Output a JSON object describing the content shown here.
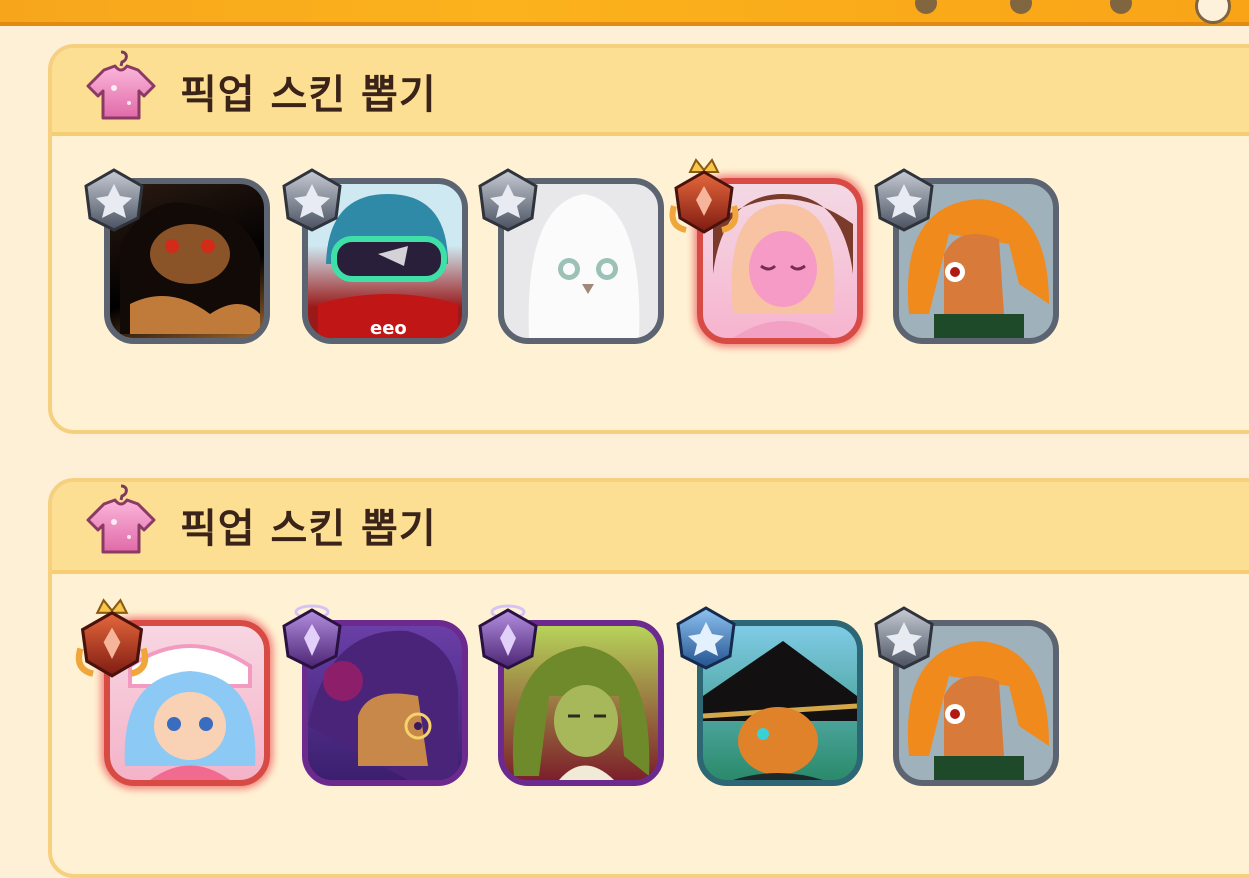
{
  "colors": {
    "panel_bg": "#fff2d4",
    "header_bg": "#fddf93",
    "title_text": "#3a2318",
    "frame_common": "#5b6470",
    "frame_legendary": "#d84a44",
    "frame_epic": "#6c2a8e",
    "frame_rare": "#2d6674"
  },
  "sections": [
    {
      "title": "픽업 스킨 뽑기",
      "icon": "shirt-icon",
      "skins": [
        {
          "grade": "common",
          "badge": "silver-gem-icon",
          "portrait": "dark-beast-cookie"
        },
        {
          "grade": "common",
          "badge": "silver-gem-icon",
          "portrait": "goggles-helmet-cookie"
        },
        {
          "grade": "common",
          "badge": "silver-gem-icon",
          "portrait": "white-ghost-cookie"
        },
        {
          "grade": "legendary",
          "badge": "red-crown-gem-icon",
          "portrait": "pink-princess-cookie"
        },
        {
          "grade": "common",
          "badge": "silver-gem-icon",
          "portrait": "orange-hair-cookie"
        }
      ]
    },
    {
      "title": "픽업 스킨 뽑기",
      "icon": "shirt-icon",
      "skins": [
        {
          "grade": "legendary",
          "badge": "red-crown-gem-icon",
          "portrait": "blue-hair-maid-cookie"
        },
        {
          "grade": "epic",
          "badge": "purple-halo-gem-icon",
          "portrait": "purple-rose-cookie"
        },
        {
          "grade": "epic",
          "badge": "purple-halo-gem-icon",
          "portrait": "green-hair-cookie"
        },
        {
          "grade": "rare",
          "badge": "blue-gem-icon",
          "portrait": "black-hat-cookie"
        },
        {
          "grade": "common",
          "badge": "silver-gem-icon",
          "portrait": "orange-hair-cookie"
        }
      ]
    }
  ]
}
